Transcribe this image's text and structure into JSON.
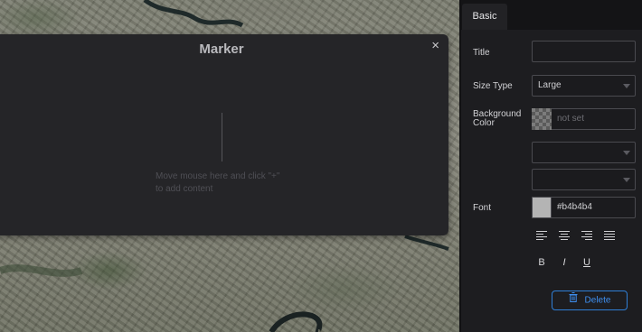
{
  "modal": {
    "title": "Marker",
    "close_glyph": "×",
    "hint_line1": "Move mouse here and click \"+\"",
    "hint_line2": "to add content"
  },
  "panel": {
    "tab_label": "Basic",
    "title_label": "Title",
    "title_value": "",
    "size_type_label": "Size Type",
    "size_type_value": "Large",
    "bg_color_label": "Background\nColor",
    "bg_color_value": "not set",
    "select1_value": "",
    "select2_value": "",
    "font_label": "Font",
    "font_color_value": "#b4b4b4",
    "align_icons": [
      "align-left-icon",
      "align-center-icon",
      "align-right-icon",
      "align-justify-icon"
    ],
    "bold_label": "B",
    "italic_label": "I",
    "underline_label": "U",
    "delete_label": "Delete"
  },
  "colors": {
    "accent": "#2f7fd6",
    "font_swatch": "#b4b4b4",
    "panel_bg": "#1d1d20",
    "modal_bg": "#252528"
  }
}
